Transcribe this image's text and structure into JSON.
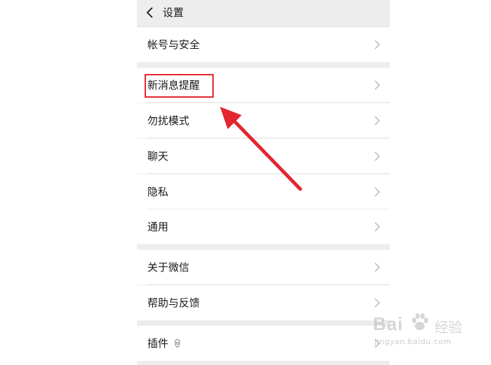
{
  "header": {
    "title": "设置",
    "back_icon": "chevron-left-icon"
  },
  "groups": [
    {
      "items": [
        {
          "label": "帐号与安全"
        }
      ]
    },
    {
      "items": [
        {
          "label": "新消息提醒"
        },
        {
          "label": "勿扰模式"
        },
        {
          "label": "聊天"
        },
        {
          "label": "隐私"
        },
        {
          "label": "通用"
        }
      ]
    },
    {
      "items": [
        {
          "label": "关于微信"
        },
        {
          "label": "帮助与反馈"
        }
      ]
    },
    {
      "items": [
        {
          "label": "插件",
          "badge_icon": "plugin-badge-icon"
        }
      ]
    }
  ],
  "annotation": {
    "highlight_color": "#e3262f",
    "arrow_color": "#e3262f"
  },
  "watermark": {
    "brand": "Bai",
    "brand_cn": "经验",
    "url": "jingyan.baidu.com"
  },
  "colors": {
    "page_bg": "#ededed",
    "row_bg": "#ffffff",
    "text": "#191919",
    "chevron": "#b2b2b2"
  }
}
